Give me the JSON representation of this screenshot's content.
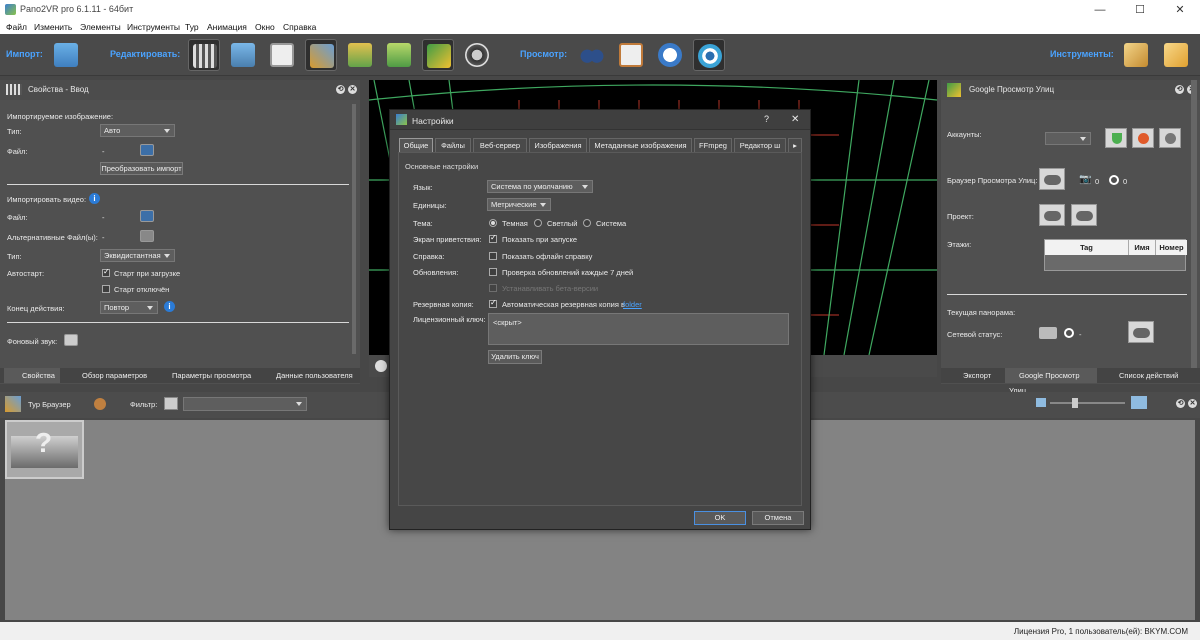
{
  "window": {
    "title": "Pano2VR pro 6.1.11 - 64бит",
    "minimize": "—",
    "maximize": "☐",
    "close": "✕"
  },
  "menu": [
    "Файл",
    "Изменить",
    "Элементы",
    "Инструменты",
    "Тур",
    "Анимация",
    "Окно",
    "Справка"
  ],
  "toolbar": {
    "import_label": "Импорт:",
    "edit_label": "Редактировать:",
    "view_label": "Просмотр:",
    "tools_label": "Инструменты:"
  },
  "left_panel": {
    "title": "Свойства - Ввод",
    "imported_image": "Импортируемое изображение:",
    "type_label": "Тип:",
    "type_value": "Авто",
    "file_label": "Файл:",
    "file_value": "-",
    "convert_button": "Преобразовать импорт",
    "import_video": "Импортировать видео:",
    "video_file_label": "Файл:",
    "video_file_value": "-",
    "alt_files_label": "Альтернативные Файл(ы):",
    "alt_files_value": "-",
    "video_type_label": "Тип:",
    "video_type_value": "Эквидистантная",
    "autostart_label": "Автостарт:",
    "autostart_opt1": "Старт при загрузке",
    "autostart_opt2": "Старт отключён",
    "end_action_label": "Конец действия:",
    "end_action_value": "Повтор",
    "bg_sound_label": "Фоновый звук:",
    "tabs": [
      "Свойства",
      "Обзор параметров",
      "Параметры просмотра",
      "Данные пользователя"
    ]
  },
  "right_panel": {
    "title": "Google Просмотр Улиц",
    "accounts_label": "Аккаунты:",
    "browser_label": "Браузер Просмотра Улиц:",
    "photo_count": "0",
    "view_count": "0",
    "project_label": "Проект:",
    "floors_label": "Этажи:",
    "floors_table": {
      "headers": [
        "Tag",
        "Имя",
        "Номер"
      ]
    },
    "current_pano_label": "Текущая панорама:",
    "network_status_label": "Сетевой статус:",
    "network_status_value": "-",
    "tabs": [
      "Экспорт",
      "Google Просмотр Улиц",
      "Список действий"
    ]
  },
  "tour_browser": {
    "title": "Тур Браузер",
    "filter_label": "Фильтр:"
  },
  "dialog": {
    "title": "Настройки",
    "help": "?",
    "close": "✕",
    "tabs": [
      "Общие",
      "Файлы",
      "Веб-сервер",
      "Изображения",
      "Метаданные изображения",
      "FFmpeg",
      "Редактор ш"
    ],
    "section": "Основные настройки",
    "lang_label": "Язык:",
    "lang_value": "Система по умолчанию",
    "units_label": "Единицы:",
    "units_value": "Метрические",
    "theme_label": "Тема:",
    "theme_dark": "Темная",
    "theme_light": "Светлый",
    "theme_system": "Система",
    "welcome_label": "Экран приветствия:",
    "welcome_opt": "Показать при запуске",
    "help_label": "Справка:",
    "help_opt": "Показать офлайн справку",
    "updates_label": "Обновления:",
    "updates_opt": "Проверка обновлений каждые 7 дней",
    "beta_opt": "Устанавливать бета-версии",
    "backup_label": "Резервная копия:",
    "backup_opt": "Автоматическая резервная копия в",
    "backup_link": "folder",
    "license_label": "Лицензионный ключ:",
    "license_value": "<скрыт>",
    "delete_key": "Удалить ключ",
    "ok": "OK",
    "cancel": "Отмена"
  },
  "status": {
    "license": "Лицензия Pro, 1 пользователь(ей): BKYM.COM"
  },
  "colors": {
    "accent": "#4aa3ff",
    "grid_green": "#3fa860",
    "grid_red": "#c0392b"
  }
}
